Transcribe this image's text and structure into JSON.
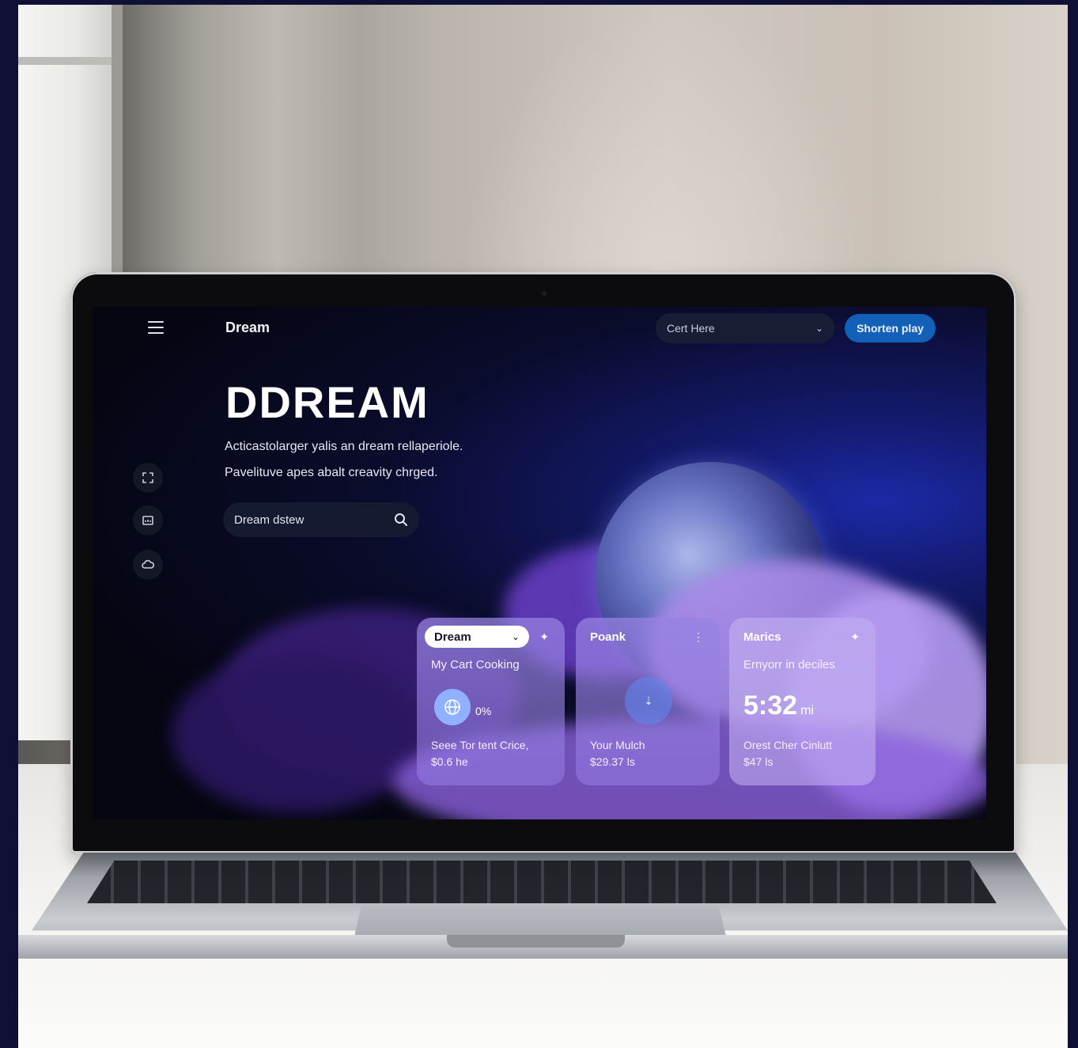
{
  "app": {
    "title": "Dream",
    "menu_icon": "hamburger-icon"
  },
  "header": {
    "select": {
      "value": "Cert Here",
      "icon": "chevron-down-icon"
    },
    "primary_button": "Shorten play"
  },
  "hero": {
    "title": "DDREAM",
    "line1": "Acticastolarger yalis an dream rellaperiole.",
    "line2": "Pavelituve apes abalt creavity chrged."
  },
  "search": {
    "value": "Dream dstew",
    "icon": "search-icon"
  },
  "sidebar": {
    "icons": [
      "expand-icon",
      "screen-icon",
      "cloud-icon"
    ]
  },
  "cards": [
    {
      "pill_label": "Dream",
      "pill_icon": "chevron-down-icon",
      "action_icon": "sparkle-icon",
      "subtitle": "My Cart Cooking",
      "percent": "0%",
      "line1": "Seee Tor tent Crice,",
      "line2": "$0.6 he",
      "icon": "globe-icon"
    },
    {
      "title": "Poank",
      "action_icon": "kebab-icon",
      "line1": "Your Mulch",
      "line2": "$29.37 ls",
      "icon": "download-icon"
    },
    {
      "title": "Marics",
      "action_icon": "sparkle-icon",
      "subtitle": "Ernyorr in deciles",
      "time": "5:32",
      "time_unit": "mi",
      "line1": "Orest Cher Cinlutt",
      "line2": "$47 ls"
    }
  ],
  "colors": {
    "accent": "#1260b8",
    "card": "#9682e1",
    "screen_bg": "#050612"
  }
}
